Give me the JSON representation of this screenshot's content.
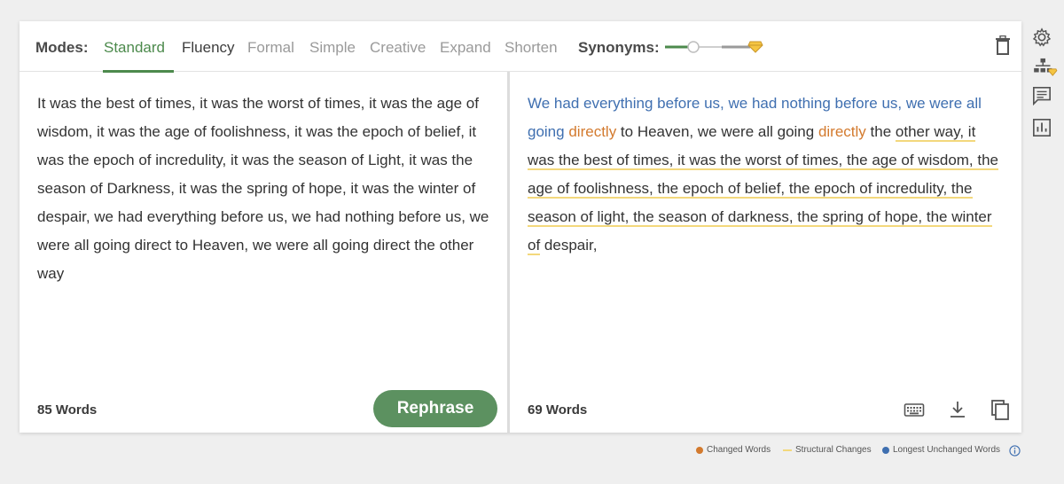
{
  "modes": {
    "label": "Modes:",
    "items": [
      "Standard",
      "Fluency",
      "Formal",
      "Simple",
      "Creative",
      "Expand",
      "Shorten"
    ],
    "active": "Standard"
  },
  "synonyms": {
    "label": "Synonyms:",
    "level": 0.3
  },
  "input": {
    "text": "It was the best of times, it was the worst of times, it was the age of wisdom, it was the age of foolishness, it was the epoch of belief, it was the epoch of incredulity, it was the season of Light, it was the season of Darkness, it was the spring of hope, it was the winter of despair, we had everything before us, we had nothing before us, we were all going direct to Heaven, we were all going direct the other way",
    "word_count": "85 Words",
    "button": "Rephrase"
  },
  "output": {
    "seg1": "We had everything before us, we had nothing before us, we were all going",
    "seg2": " ",
    "seg3": "directly",
    "seg4": " to Heaven, we were all going ",
    "seg5": "directly",
    "seg6": " the ",
    "seg7": "other way, it was the best of times, it was the worst of times, the age of wisdom, the age of foolishness, the epoch of belief, the epoch of incredulity, the season of light, the season of darkness, the spring of hope, the winter of",
    "seg8": " despair,",
    "word_count": "69 Words"
  },
  "legend": {
    "changed": "Changed Words",
    "structural": "Structural Changes",
    "unchanged": "Longest Unchanged Words"
  },
  "colors": {
    "accent": "#4c8a4c",
    "changed": "#d37a2e",
    "structural": "#f3d87c",
    "unchanged": "#3f6fb0"
  },
  "icons": {
    "trash": "trash-icon",
    "settings": "gear-icon",
    "compare": "compare-icon",
    "feedback": "comment-icon",
    "stats": "stats-icon",
    "keyboard": "keyboard-icon",
    "download": "download-icon",
    "copy": "copy-icon",
    "info": "info-icon",
    "premium": "diamond-icon"
  }
}
